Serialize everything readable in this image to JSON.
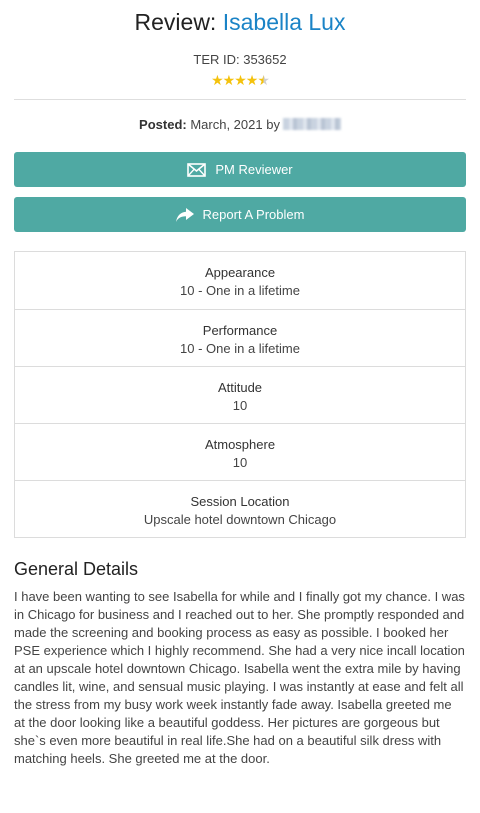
{
  "review": {
    "prefix": "Review:",
    "name": "Isabella Lux",
    "ter_id_label": "TER ID: 353652",
    "rating": 4.5,
    "posted_label": "Posted:",
    "posted_value": "March, 2021 by"
  },
  "buttons": {
    "pm_label": "PM Reviewer",
    "report_label": "Report A Problem"
  },
  "ratings": [
    {
      "label": "Appearance",
      "value": "10 - One in a lifetime"
    },
    {
      "label": "Performance",
      "value": "10 - One in a lifetime"
    },
    {
      "label": "Attitude",
      "value": "10"
    },
    {
      "label": "Atmosphere",
      "value": "10"
    },
    {
      "label": "Session Location",
      "value": "Upscale hotel downtown Chicago"
    }
  ],
  "general": {
    "title": "General Details",
    "text": "I have been wanting to see Isabella for while and I finally got my chance. I was in Chicago for business and I reached out to her. She promptly responded and made the screening and booking process as easy as possible. I booked her PSE experience which I highly recommend. She had a very nice incall location at an upscale hotel downtown Chicago. Isabella went the extra mile by having candles lit, wine, and sensual music playing. I was instantly at ease and felt all the stress from my busy work week instantly fade away. Isabella greeted me at the door looking like a beautiful goddess. Her pictures are gorgeous but she`s even more beautiful in real life.She had on a beautiful silk dress with matching heels. She greeted me at the door."
  },
  "colors": {
    "accent": "#4fa9a3",
    "link": "#1a83c6",
    "star": "#f4c20d"
  }
}
